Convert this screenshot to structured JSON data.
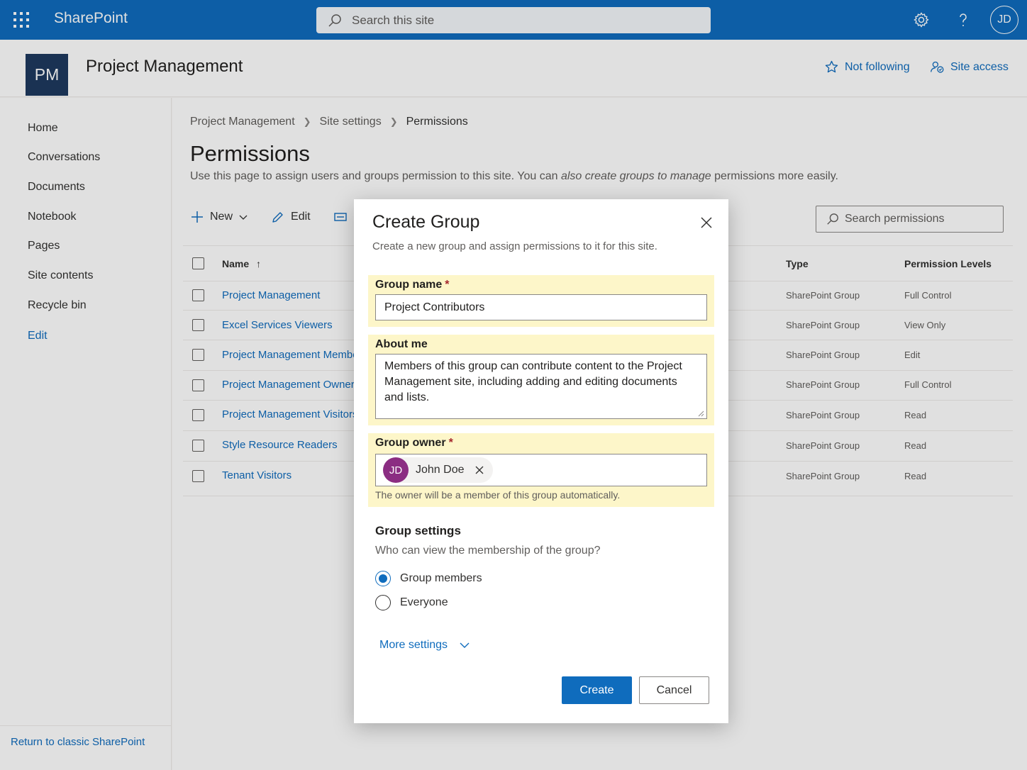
{
  "suite": {
    "brand": "SharePoint",
    "search_placeholder": "Search this site",
    "user_initials": "JD"
  },
  "site": {
    "logo": "PM",
    "title": "Project Management",
    "follow_label": "Not following",
    "access_label": "Site access"
  },
  "nav": {
    "items": [
      "Home",
      "Conversations",
      "Documents",
      "Notebook",
      "Pages",
      "Site contents",
      "Recycle bin"
    ],
    "edit_label": "Edit",
    "return_label": "Return to classic SharePoint"
  },
  "breadcrumb": [
    "Project Management",
    "Site settings",
    "Permissions"
  ],
  "page": {
    "title": "Permissions",
    "desc_plain_1": "Use this page to assign users and groups permission to this site. You can ",
    "desc_italic": "also create groups to manage",
    "desc_plain_2": " permissions more easily."
  },
  "commands": {
    "new_label": "New",
    "edit_label": "Edit",
    "search_placeholder": "Search permissions"
  },
  "table": {
    "headers": {
      "name": "Name",
      "type": "Type",
      "perm": "Permission Levels"
    },
    "rows": [
      {
        "name": "Project Management",
        "type": "SharePoint Group",
        "perm": "Full Control"
      },
      {
        "name": "Excel Services Viewers",
        "type": "SharePoint Group",
        "perm": "View Only"
      },
      {
        "name": "Project Management Members",
        "type": "SharePoint Group",
        "perm": "Edit"
      },
      {
        "name": "Project Management Owners",
        "type": "SharePoint Group",
        "perm": "Full Control"
      },
      {
        "name": "Project Management Visitors",
        "type": "SharePoint Group",
        "perm": "Read"
      },
      {
        "name": "Style Resource Readers",
        "type": "SharePoint Group",
        "perm": "Read"
      },
      {
        "name": "Tenant Visitors",
        "type": "SharePoint Group",
        "perm": "Read"
      }
    ]
  },
  "dialog": {
    "title": "Create Group",
    "subtitle": "Create a new group and assign permissions to it for this site.",
    "group_name_label": "Group name",
    "group_name_value": "Project Contributors",
    "required_mark": "*",
    "about_label": "About me",
    "about_value": "Members of this group can contribute content to the Project Management site, including adding and editing documents and lists.",
    "owner_label": "Group owner",
    "owner_initials": "JD",
    "owner_name": "John Doe",
    "owner_hint": "The owner will be a member of this group automatically.",
    "settings_title": "Group settings",
    "settings_question": "Who can view the membership of the group?",
    "option_members": "Group members",
    "option_everyone": "Everyone",
    "more_settings": "More settings",
    "create_label": "Create",
    "cancel_label": "Cancel"
  },
  "colors": {
    "accent": "#0f6cbd",
    "highlight": "#fdf6c9",
    "owner_avatar": "#8b2d82"
  }
}
